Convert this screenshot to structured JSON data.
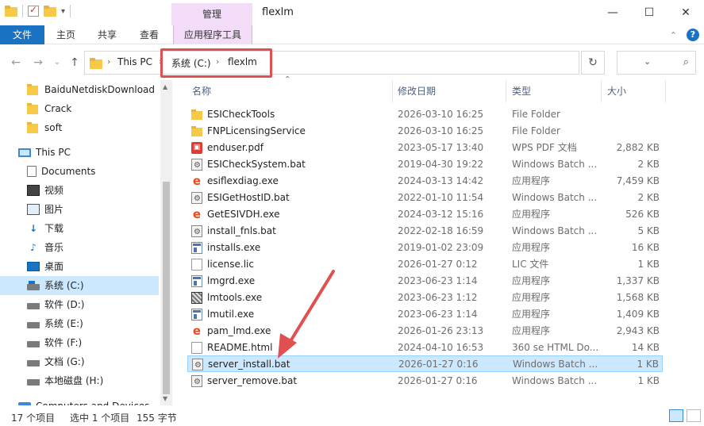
{
  "window": {
    "title": "flexlm",
    "contextual_tab_header": "管理",
    "controls": {
      "minimize": "—",
      "maximize": "☐",
      "close": "✕"
    }
  },
  "ribbon": {
    "tabs": [
      "文件",
      "主页",
      "共享",
      "查看",
      "应用程序工具"
    ],
    "expand_glyph": "⌃",
    "help_glyph": "?"
  },
  "address": {
    "crumbs": [
      "This PC",
      "系统 (C:)",
      "flexlm"
    ],
    "sep": "›",
    "dropdown": "⌄",
    "refresh": "↻",
    "search_placeholder": "",
    "search_icon": "⌕"
  },
  "nav_buttons": {
    "back": "←",
    "forward": "→",
    "recent": "⌄",
    "up": "↑"
  },
  "navpane": {
    "items": [
      {
        "label": "BaiduNetdiskDownload",
        "icon": "folder-icon"
      },
      {
        "label": "Crack",
        "icon": "folder-icon"
      },
      {
        "label": "soft",
        "icon": "folder-icon"
      },
      {
        "label": "This PC",
        "icon": "pc-icon"
      },
      {
        "label": "Documents",
        "icon": "documents-icon"
      },
      {
        "label": "视频",
        "icon": "video-icon"
      },
      {
        "label": "图片",
        "icon": "pictures-icon"
      },
      {
        "label": "下载",
        "icon": "download-icon"
      },
      {
        "label": "音乐",
        "icon": "music-icon"
      },
      {
        "label": "桌面",
        "icon": "desktop-icon"
      },
      {
        "label": "系统 (C:)",
        "icon": "drive-icon"
      },
      {
        "label": "软件 (D:)",
        "icon": "drive-icon"
      },
      {
        "label": "系统 (E:)",
        "icon": "drive-icon"
      },
      {
        "label": "软件 (F:)",
        "icon": "drive-icon"
      },
      {
        "label": "文档 (G:)",
        "icon": "drive-icon"
      },
      {
        "label": "本地磁盘 (H:)",
        "icon": "drive-icon"
      },
      {
        "label": "Computers and Devices",
        "icon": "network-icon"
      }
    ],
    "selected": "系统 (C:)"
  },
  "columns": {
    "name": "名称",
    "date": "修改日期",
    "type": "类型",
    "size": "大小"
  },
  "files": [
    {
      "name": "ESICheckTools",
      "date": "2026-03-10 16:25",
      "type": "File Folder",
      "size": "",
      "icon": "folder"
    },
    {
      "name": "FNPLicensingService",
      "date": "2026-03-10 16:25",
      "type": "File Folder",
      "size": "",
      "icon": "folder"
    },
    {
      "name": "enduser.pdf",
      "date": "2023-05-17 13:40",
      "type": "WPS PDF 文档",
      "size": "2,882 KB",
      "icon": "pdf"
    },
    {
      "name": "ESICheckSystem.bat",
      "date": "2019-04-30 19:22",
      "type": "Windows Batch ...",
      "size": "2 KB",
      "icon": "bat"
    },
    {
      "name": "esiflexdiag.exe",
      "date": "2024-03-13 14:42",
      "type": "应用程序",
      "size": "7,459 KB",
      "icon": "e"
    },
    {
      "name": "ESIGetHostID.bat",
      "date": "2022-01-10 11:54",
      "type": "Windows Batch ...",
      "size": "2 KB",
      "icon": "bat"
    },
    {
      "name": "GetESIVDH.exe",
      "date": "2024-03-12 15:16",
      "type": "应用程序",
      "size": "526 KB",
      "icon": "e"
    },
    {
      "name": "install_fnls.bat",
      "date": "2022-02-18 16:59",
      "type": "Windows Batch ...",
      "size": "5 KB",
      "icon": "bat"
    },
    {
      "name": "installs.exe",
      "date": "2019-01-02 23:09",
      "type": "应用程序",
      "size": "16 KB",
      "icon": "app"
    },
    {
      "name": "license.lic",
      "date": "2026-01-27 0:12",
      "type": "LIC 文件",
      "size": "1 KB",
      "icon": "file"
    },
    {
      "name": "lmgrd.exe",
      "date": "2023-06-23 1:14",
      "type": "应用程序",
      "size": "1,337 KB",
      "icon": "app"
    },
    {
      "name": "lmtools.exe",
      "date": "2023-06-23 1:12",
      "type": "应用程序",
      "size": "1,568 KB",
      "icon": "tools"
    },
    {
      "name": "lmutil.exe",
      "date": "2023-06-23 1:14",
      "type": "应用程序",
      "size": "1,409 KB",
      "icon": "app"
    },
    {
      "name": "pam_lmd.exe",
      "date": "2026-01-26 23:13",
      "type": "应用程序",
      "size": "2,943 KB",
      "icon": "e"
    },
    {
      "name": "README.html",
      "date": "2024-04-10 16:53",
      "type": "360 se HTML Do...",
      "size": "14 KB",
      "icon": "file"
    },
    {
      "name": "server_install.bat",
      "date": "2026-01-27 0:16",
      "type": "Windows Batch ...",
      "size": "1 KB",
      "icon": "bat"
    },
    {
      "name": "server_remove.bat",
      "date": "2026-01-27 0:16",
      "type": "Windows Batch ...",
      "size": "1 KB",
      "icon": "bat"
    }
  ],
  "selected_file": "server_install.bat",
  "status": {
    "count": "17 个项目",
    "selection": "选中 1 个项目",
    "bytes": "155 字节"
  },
  "annotation": {
    "color": "#e05050"
  }
}
